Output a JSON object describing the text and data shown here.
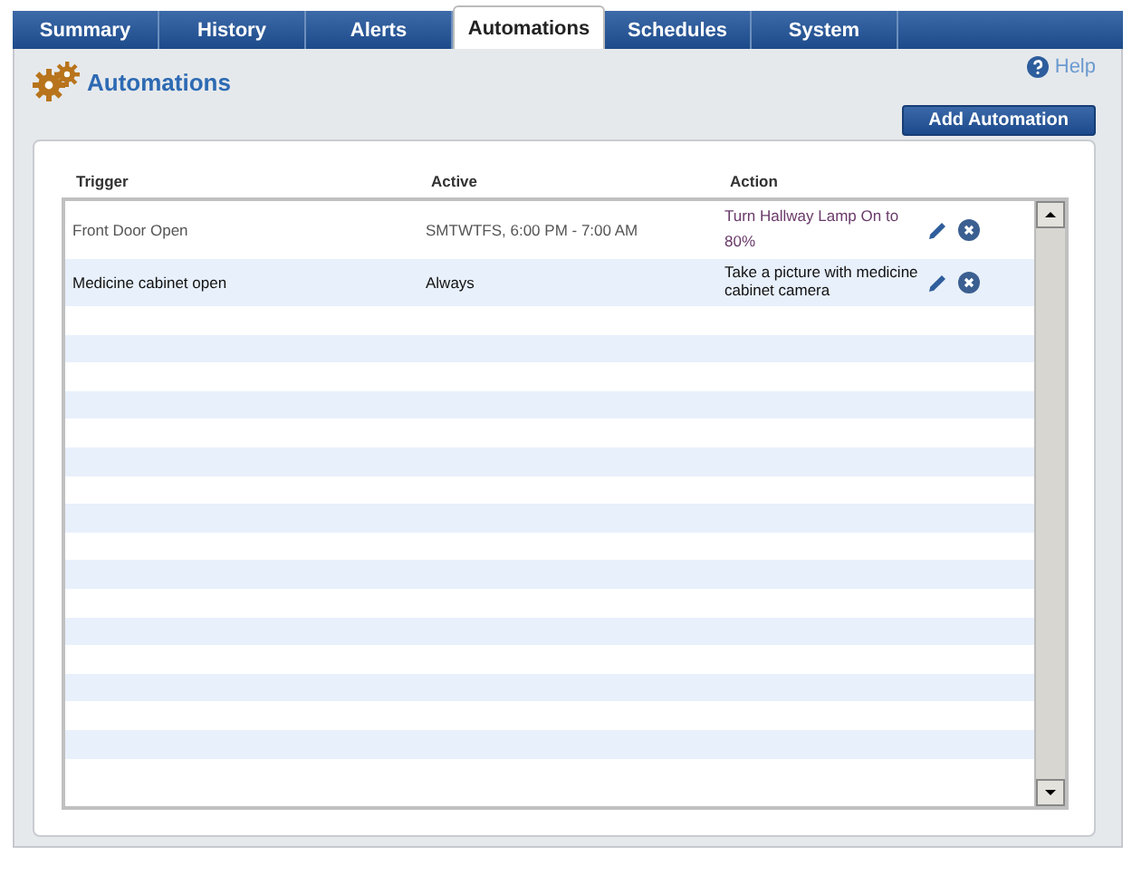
{
  "tabs": [
    {
      "label": "Summary",
      "selected": false
    },
    {
      "label": "History",
      "selected": false
    },
    {
      "label": "Alerts",
      "selected": false
    },
    {
      "label": "Automations",
      "selected": true
    },
    {
      "label": "Schedules",
      "selected": false
    },
    {
      "label": "System",
      "selected": false
    }
  ],
  "page": {
    "title": "Automations",
    "help": "Help",
    "add_button": "Add Automation"
  },
  "table": {
    "columns": [
      "Trigger",
      "Active",
      "Action"
    ],
    "rows": [
      {
        "trigger": "Front Door Open",
        "active": "SMTWTFS, 6:00 PM - 7:00 AM",
        "action": "Turn Hallway Lamp On to 80%"
      },
      {
        "trigger": "Medicine cabinet open",
        "active": "Always",
        "action": "Take a picture with medicine cabinet camera"
      }
    ]
  }
}
